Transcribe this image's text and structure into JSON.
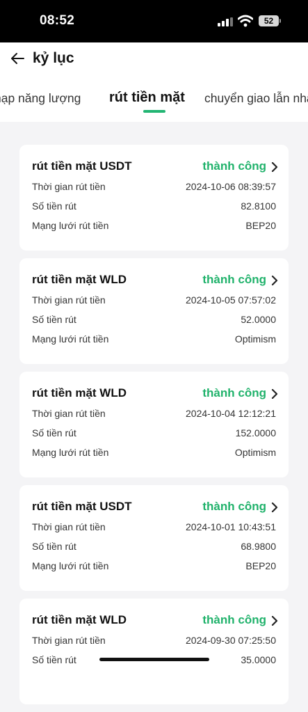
{
  "status": {
    "time": "08:52",
    "battery": "52"
  },
  "header": {
    "title": "kỷ lục"
  },
  "tabs": [
    {
      "label": "nạp năng lượng",
      "active": false
    },
    {
      "label": "rút tiền mặt",
      "active": true
    },
    {
      "label": "chuyển giao lẫn nhau",
      "active": false
    }
  ],
  "labels": {
    "time": "Thời gian rút tiền",
    "amount": "Số tiền rút",
    "network": "Mạng lưới rút tiền"
  },
  "records": [
    {
      "title": "rút tiền mặt  USDT",
      "status": "thành công",
      "time": "2024-10-06 08:39:57",
      "amount": "82.8100",
      "network": "BEP20"
    },
    {
      "title": "rút tiền mặt  WLD",
      "status": "thành công",
      "time": "2024-10-05 07:57:02",
      "amount": "52.0000",
      "network": "Optimism"
    },
    {
      "title": "rút tiền mặt  WLD",
      "status": "thành công",
      "time": "2024-10-04 12:12:21",
      "amount": "152.0000",
      "network": "Optimism"
    },
    {
      "title": "rút tiền mặt  USDT",
      "status": "thành công",
      "time": "2024-10-01 10:43:51",
      "amount": "68.9800",
      "network": "BEP20"
    },
    {
      "title": "rút tiền mặt  WLD",
      "status": "thành công",
      "time": "2024-09-30 07:25:50",
      "amount": "35.0000",
      "network": ""
    }
  ],
  "colors": {
    "accent": "#22b573",
    "success": "#20b26b",
    "background": "#f4f4f6"
  }
}
